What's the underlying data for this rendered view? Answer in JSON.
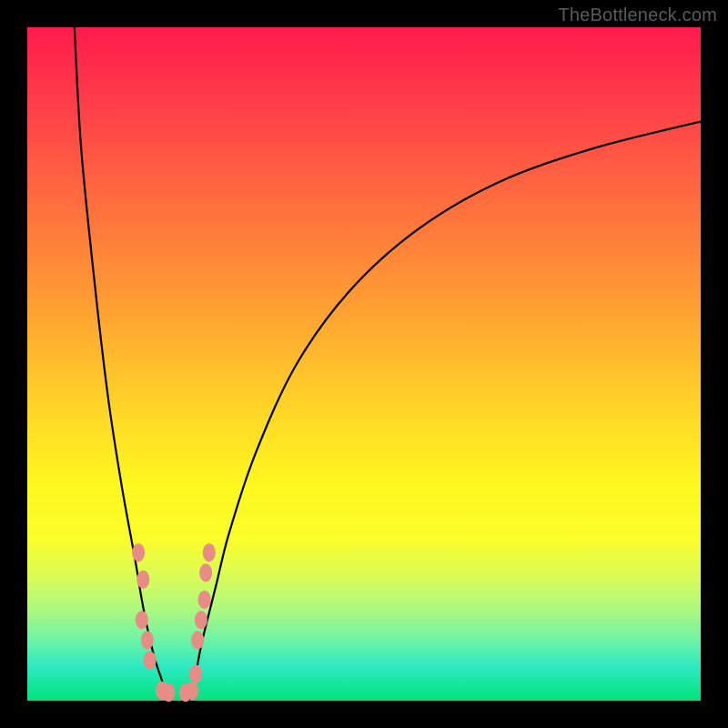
{
  "watermark": "TheBottleneck.com",
  "colors": {
    "frame": "#000000",
    "curve": "#000000",
    "marker": "#e78d85",
    "gradient_top": "#ff1a4b",
    "gradient_bottom": "#00e37a"
  },
  "chart_data": {
    "type": "line",
    "title": "",
    "xlabel": "",
    "ylabel": "",
    "xlim": [
      0,
      100
    ],
    "ylim": [
      0,
      100
    ],
    "note": "No axis ticks or numeric labels are rendered in the source image; x/y values below are relative percentages of the plot area estimated from pixel positions.",
    "series": [
      {
        "name": "left-branch",
        "x": [
          7,
          8,
          10,
          12,
          14,
          16,
          17,
          18,
          19,
          20,
          21
        ],
        "y": [
          100,
          82,
          62,
          45,
          32,
          21,
          15,
          10,
          6,
          3,
          0
        ]
      },
      {
        "name": "right-branch",
        "x": [
          24,
          25,
          26,
          28,
          30,
          34,
          40,
          48,
          58,
          70,
          84,
          100
        ],
        "y": [
          0,
          4,
          9,
          17,
          25,
          37,
          50,
          61,
          70,
          77,
          82,
          86
        ]
      }
    ],
    "markers": {
      "name": "data-points",
      "x": [
        16.5,
        17.2,
        17.0,
        17.8,
        18.2,
        20.0,
        21.0,
        23.5,
        24.5,
        25.0,
        25.3,
        25.8,
        26.3,
        26.5,
        27.0
      ],
      "y": [
        22,
        18,
        12,
        9,
        6,
        1.5,
        1.2,
        1.2,
        1.5,
        4,
        9,
        12,
        15,
        19,
        22
      ]
    }
  }
}
